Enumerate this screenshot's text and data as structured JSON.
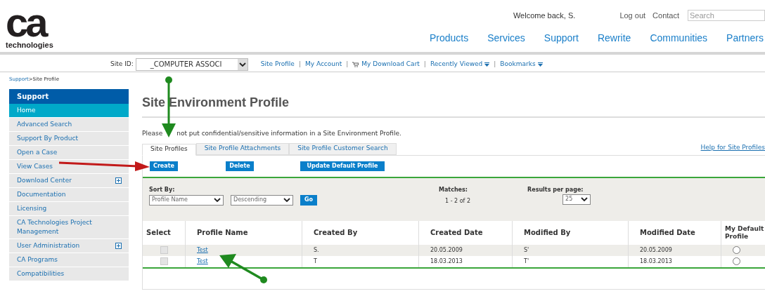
{
  "header": {
    "logo_word": "ca",
    "logo_sub": "technologies",
    "welcome": "Welcome back, S.",
    "links": [
      "Log out",
      "Contact"
    ],
    "search": {
      "placeholder": "Search"
    },
    "nav": [
      "Products",
      "Services",
      "Support",
      "Rewrite",
      "Communities",
      "Partners"
    ]
  },
  "site_bar": {
    "label": "Site ID:",
    "separator": "|",
    "site_value": "_COMPUTER ASSOCI",
    "links": [
      {
        "label": "Site Profile",
        "kind": "plain"
      },
      {
        "label": "My Account",
        "kind": "plain"
      },
      {
        "label": "My Download Cart",
        "kind": "cart"
      },
      {
        "label": "Recently Viewed",
        "kind": "menu"
      },
      {
        "label": "Bookmarks",
        "kind": "menu"
      }
    ]
  },
  "breadcrumb": {
    "link": "Support",
    "current": "Site Profile",
    "separator": ">"
  },
  "sidebar": {
    "title": "Support",
    "items": [
      {
        "label": "Home",
        "selected": true,
        "expandable": false
      },
      {
        "label": "Advanced Search",
        "selected": false,
        "expandable": false
      },
      {
        "label": "Support By Product",
        "selected": false,
        "expandable": false
      },
      {
        "label": "Open a Case",
        "selected": false,
        "expandable": false
      },
      {
        "label": "View Cases",
        "selected": false,
        "expandable": false
      },
      {
        "label": "Download Center",
        "selected": false,
        "expandable": true
      },
      {
        "label": "Documentation",
        "selected": false,
        "expandable": false
      },
      {
        "label": "Licensing",
        "selected": false,
        "expandable": false
      },
      {
        "label": "CA Technologies Project Management",
        "selected": false,
        "expandable": false
      },
      {
        "label": "User Administration",
        "selected": false,
        "expandable": true
      },
      {
        "label": "CA Programs",
        "selected": false,
        "expandable": false
      },
      {
        "label": "Compatibilities",
        "selected": false,
        "expandable": false
      }
    ]
  },
  "page": {
    "title": "Site Environment Profile",
    "notice_start": "Please",
    "notice_rest": "not put confidential/sensitive information in a Site Environment Profile.",
    "help_link": "Help for Site Profiles",
    "tabs": [
      {
        "label": "Site Profiles",
        "selected": true
      },
      {
        "label": "Site Profile Attachments",
        "selected": false
      },
      {
        "label": "Site Profile Customer Search",
        "selected": false
      }
    ],
    "buttons": [
      "Create",
      "Delete",
      "Update Default Profile"
    ],
    "sort": {
      "label": "Sort By:",
      "field": "Profile Name",
      "order": "Descending",
      "go": "Go"
    },
    "matches": {
      "label": "Matches:",
      "value": "1 - 2 of 2"
    },
    "per_page": {
      "label": "Results per page:",
      "value": "25"
    },
    "table": {
      "columns": [
        "Select",
        "Profile Name",
        "Created By",
        "Created Date",
        "Modified By",
        "Modified Date",
        "My Default Profile"
      ],
      "rows": [
        {
          "checked": false,
          "name": "Test",
          "created_by": "S.",
          "created_date": "20.05.2009",
          "modified_by": "S'",
          "modified_date": "20.05.2009",
          "default": false
        },
        {
          "checked": false,
          "name": "Test",
          "created_by": "T",
          "created_date": "18.03.2013",
          "modified_by": "T'",
          "modified_date": "18.03.2013",
          "default": false
        }
      ]
    }
  }
}
